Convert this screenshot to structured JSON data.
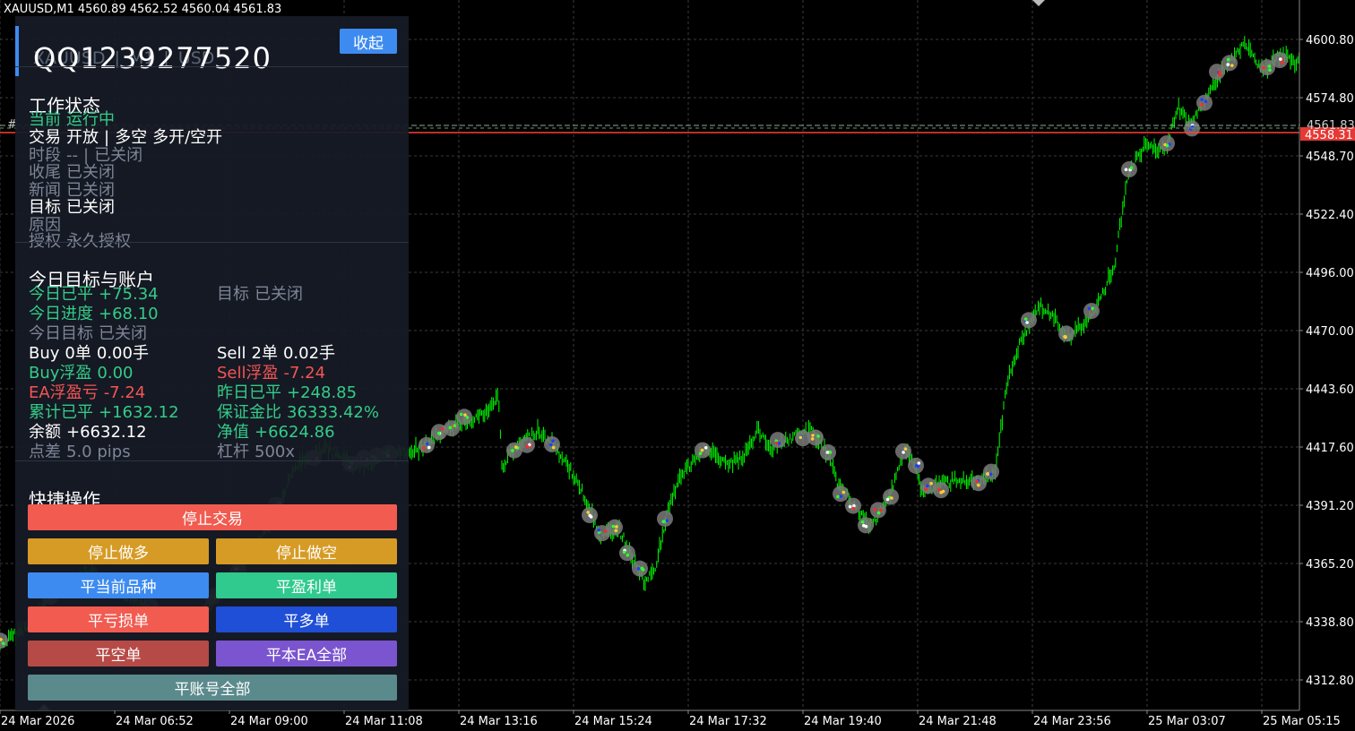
{
  "symbol_info": "XAUUSD,M1  4560.89 4562.52 4560.04 4561.83",
  "colors": {
    "background": "#000000",
    "grid": "#3a3a3a",
    "candles": "#00ff00",
    "bid_line": "#ff3b3b",
    "ask_line": "#9aa0a6",
    "panel_bg": "#171b26",
    "accent": "#3d8bf0"
  },
  "price_axis": {
    "labels": [
      "4600.80",
      "4574.80",
      "4548.70",
      "4522.40",
      "4496.00",
      "4470.00",
      "4443.60",
      "4417.60",
      "4391.20",
      "4365.20",
      "4338.80",
      "4312.80"
    ],
    "current_bid": "4558.31",
    "current_ask": "4561.83"
  },
  "time_axis": {
    "labels": [
      "24 Mar 2026",
      "24 Mar 06:52",
      "24 Mar 09:00",
      "24 Mar 11:08",
      "24 Mar 13:16",
      "24 Mar 15:24",
      "24 Mar 17:32",
      "24 Mar 19:40",
      "24 Mar 21:48",
      "24 Mar 23:56",
      "25 Mar 03:07",
      "25 Mar 05:15"
    ]
  },
  "panel": {
    "account_id": "QQ1239277520",
    "collapse_label": "收起",
    "sub_header": [
      "XAUUSD",
      "|",
      "M1",
      "|",
      "USD"
    ],
    "status": {
      "title": "工作状态",
      "current_label": "当前",
      "current_value": "运行中",
      "trade_label": "交易",
      "trade_value": "开放",
      "trade_sep": "|",
      "trade_dir": "多空",
      "trade_mode": "多开/空开",
      "session_label": "时段",
      "session_value": "--",
      "session_sep": "|",
      "session_state": "已关闭",
      "close_label": "收尾",
      "close_value": "已关闭",
      "news_label": "新闻",
      "news_value": "已关闭",
      "target_label": "目标",
      "target_value": "已关闭",
      "reason_label": "原因",
      "license_label": "授权",
      "license_value": "永久授权"
    },
    "account": {
      "title": "今日目标与账户",
      "today_closed_label": "今日已平",
      "today_closed_value": "+75.34",
      "target_label": "目标",
      "target_value": "已关闭",
      "progress_label": "今日进度",
      "progress_value": "+68.10",
      "today_target_label": "今日目标",
      "today_target_value": "已关闭",
      "buy_label": "Buy",
      "buy_count": "0单",
      "buy_lots": "0.00手",
      "sell_label": "Sell",
      "sell_count": "2单",
      "sell_lots": "0.02手",
      "buy_float_label": "Buy浮盈",
      "buy_float_value": "0.00",
      "sell_float_label": "Sell浮盈",
      "sell_float_value": "-7.24",
      "ea_float_label": "EA浮盈亏",
      "ea_float_value": "-7.24",
      "yesterday_label": "昨日已平",
      "yesterday_value": "+248.85",
      "total_label": "累计已平",
      "total_value": "+1632.12",
      "margin_label": "保证金比",
      "margin_value": "36333.42%",
      "balance_label": "余额",
      "balance_value": "+6632.12",
      "equity_label": "净值",
      "equity_value": "+6624.86",
      "spread_label": "点差",
      "spread_value": "5.0 pips",
      "leverage_label": "杠杆",
      "leverage_value": "500x"
    },
    "actions": {
      "title": "快捷操作",
      "stop_trading": "停止交易",
      "stop_long": "停止做多",
      "stop_short": "停止做空",
      "close_symbol": "平当前品种",
      "close_profit": "平盈利单",
      "close_loss": "平亏损单",
      "close_long": "平多单",
      "close_short": "平空单",
      "close_ea_all": "平本EA全部",
      "close_account_all": "平账号全部"
    }
  }
}
